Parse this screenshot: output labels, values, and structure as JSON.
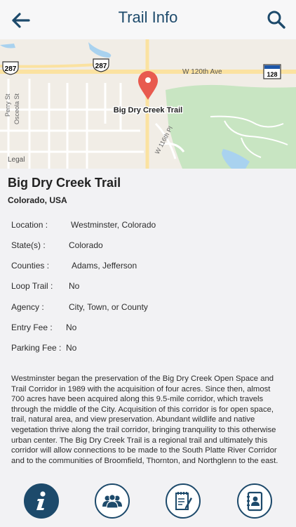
{
  "header": {
    "title": "Trail Info",
    "back_icon": "arrow-left-icon",
    "search_icon": "search-icon"
  },
  "map": {
    "pin_label": "Big Dry Creek Trail",
    "legal": "Legal",
    "road_labels": {
      "w120th": "W 120th Ave",
      "w116th": "W 116th Pl",
      "perry": "Perry St",
      "osceola": "Osceola St"
    },
    "shields": {
      "us287_a": "287",
      "us287_b": "287",
      "co128": "128"
    }
  },
  "trail": {
    "name": "Big Dry Creek Trail",
    "location": "Colorado, USA"
  },
  "details": [
    {
      "label": "Location  :",
      "value": "Westminster, Colorado"
    },
    {
      "label": "State(s)  :",
      "value": "Colorado"
    },
    {
      "label": "Counties  :",
      "value": "Adams, Jefferson"
    },
    {
      "label": "Loop Trail  :",
      "value": "No"
    },
    {
      "label": "Agency  :",
      "value": "City, Town, or County"
    },
    {
      "label": "Entry Fee  :",
      "value": "No"
    },
    {
      "label": "Parking Fee  :",
      "value": "No"
    }
  ],
  "description": "Westminster began the preservation of the Big Dry Creek Open Space and Trail Corridor in 1989 with the acquisition of four acres. Since then, almost 700 acres have been acquired along this 9.5-mile corridor, which travels through the middle of the City. Acquisition of this corridor is for open space, trail, natural area, and view preservation. Abundant wildlife and native vegetation thrive along the trail corridor, bringing tranquility to this otherwise urban center. The Big Dry Creek Trail is a regional trail and ultimately this corridor will allow connections to be made to the South Platte River Corridor and to the communities of Broomfield, Thornton, and Northglenn to the east.",
  "nav": [
    {
      "icon": "info-icon",
      "active": true
    },
    {
      "icon": "users-icon",
      "active": false
    },
    {
      "icon": "notes-icon",
      "active": false
    },
    {
      "icon": "contacts-icon",
      "active": false
    }
  ],
  "colors": {
    "accent": "#1d4a6b",
    "park_green": "#c8e5c2",
    "water": "#a9d2ef",
    "pin": "#e85a4f"
  }
}
